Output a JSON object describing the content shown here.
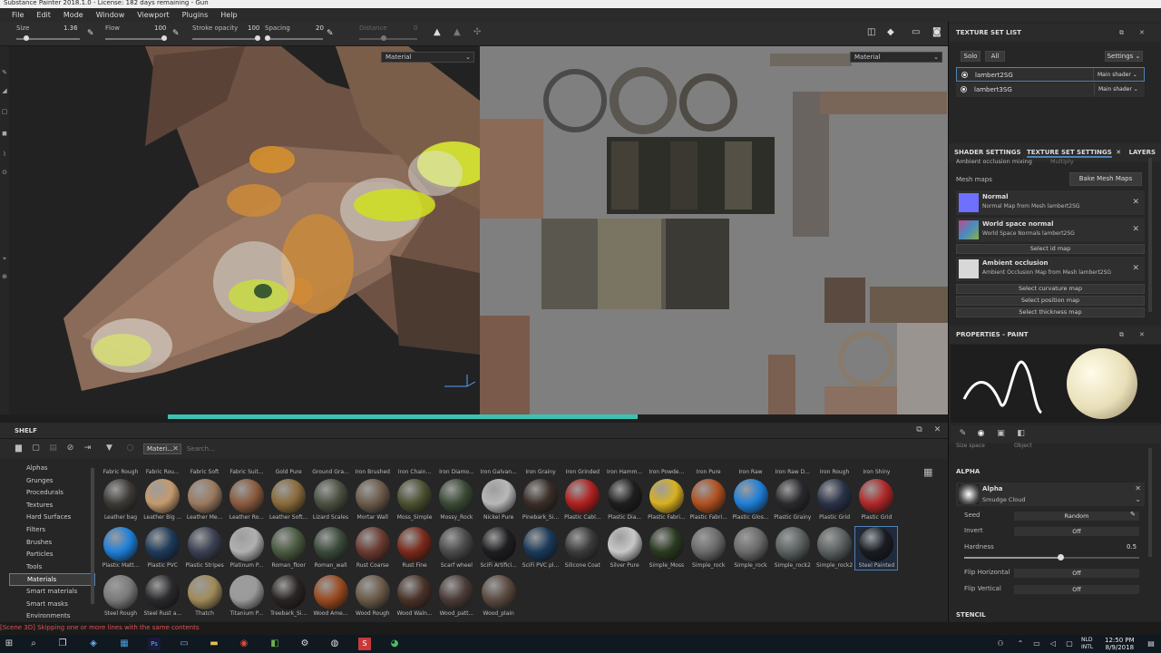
{
  "title": "Substance Painter 2018.1.0 - License: 182 days remaining - Gun",
  "menu": [
    "File",
    "Edit",
    "Mode",
    "Window",
    "Viewport",
    "Plugins",
    "Help"
  ],
  "toolbar": {
    "size_label": "Size",
    "size_value": "1.36",
    "flow_label": "Flow",
    "flow_value": "100",
    "stroke_label": "Stroke opacity",
    "stroke_value": "100",
    "spacing_label": "Spacing",
    "spacing_value": "20",
    "distance_label": "Distance"
  },
  "view3d": {
    "channel": "Material"
  },
  "view2d": {
    "channel": "Material"
  },
  "shelf": {
    "title": "SHELF",
    "filter_chip": "Materi...",
    "search_placeholder": "Search...",
    "categories": [
      "Alphas",
      "Grunges",
      "Procedurals",
      "Textures",
      "Hard Surfaces",
      "Filters",
      "Brushes",
      "Particles",
      "Tools",
      "Materials",
      "Smart materials",
      "Smart masks",
      "Environments"
    ],
    "selected_category": "Materials",
    "top_row": [
      "Fabric Rough",
      "Fabric Rou...",
      "Fabric Soft",
      "Fabric Suit...",
      "Gold Pure",
      "Ground Gra...",
      "Iron Brushed",
      "Iron Chain...",
      "Iron Diamo...",
      "Iron Galvan...",
      "Iron Grainy",
      "Iron Grinded",
      "Iron Hamm...",
      "Iron Powde...",
      "Iron Pure",
      "Iron Raw",
      "Iron Raw D...",
      "Iron Rough",
      "Iron Shiny"
    ],
    "rows": [
      [
        "Leather bag",
        "Leather Big ...",
        "Leather Me...",
        "Leather Ro...",
        "Leather Soft...",
        "Lizard Scales",
        "Mortar Wall",
        "Moss_Simple",
        "Mossy_Rock",
        "Nickel Pure",
        "Pinebark_Si...",
        "Plastic Cabl...",
        "Plastic Dia...",
        "Plastic Fabri...",
        "Plastic Fabri...",
        "Plastic Glos...",
        "Plastic Grainy",
        "Plastic Grid",
        "Plastic Grid"
      ],
      [
        "Plastic Matt...",
        "Plastic PVC",
        "Plastic Stripes",
        "Platinum P...",
        "Roman_floor",
        "Roman_wall",
        "Rust Coarse",
        "Rust Fine",
        "Scarf wheel",
        "SciFi Artifici...",
        "SciFi PVC pl...",
        "Silicone Coat",
        "Silver Pure",
        "Simple_Moss",
        "Simple_rock",
        "Simple_rock",
        "Simple_rock2",
        "Simple_rock2",
        "Steel Painted"
      ],
      [
        "Steel Rough",
        "Steel Rust a...",
        "Thatch",
        "Titanium P...",
        "Treebark_Si...",
        "Wood Ame...",
        "Wood Rough",
        "Wood Waln...",
        "Wood_patt...",
        "Wood_plain"
      ]
    ],
    "row_colors": [
      [
        "#3d3a36",
        "#c49a6e",
        "#9a7a5e",
        "#8a5a3e",
        "#8a6a3a",
        "#4a5040",
        "#6a5a4a",
        "#4a5030",
        "#3a4a35",
        "#b8b8b8",
        "#3a2e28",
        "#b02020",
        "#1e1e20",
        "#d9b020",
        "#b05020",
        "#1e7fd8",
        "#2a2a2e",
        "#2a3248",
        "#b02828"
      ],
      [
        "#1e7fd8",
        "#1e3a5a",
        "#3a4052",
        "#b0b0b0",
        "#4a5a40",
        "#3a4a3a",
        "#6a3a30",
        "#7a2a1a",
        "#4a4a4a",
        "#1e1e22",
        "#1a3a5a",
        "#3a3a3a",
        "#c8c8c8",
        "#2a3a20",
        "#6a6a6a",
        "#6a6a6a",
        "#5a6060",
        "#5a6060",
        "#1a1c22"
      ],
      [
        "#7a7a7a",
        "#2a2a2e",
        "#a08a5a",
        "#9a9a9a",
        "#2a2422",
        "#9a4a20",
        "#6a5a48",
        "#4a3228",
        "#4a3a36",
        "#5a4a40"
      ]
    ],
    "selected_material": "Steel Painted"
  },
  "texture_set_list": {
    "title": "TEXTURE SET LIST",
    "solo": "Solo",
    "all": "All",
    "settings": "Settings",
    "sets": [
      {
        "name": "lambert2SG",
        "shader": "Main shader"
      },
      {
        "name": "lambert3SG",
        "shader": "Main shader"
      }
    ]
  },
  "tabs": [
    "SHADER SETTINGS",
    "TEXTURE SET SETTINGS",
    "LAYERS"
  ],
  "tss": {
    "ao_mixing": "Ambient occlusion mixing",
    "ao_mixing_value": "Multiply",
    "mesh_maps": "Mesh maps",
    "bake": "Bake Mesh Maps",
    "maps": [
      {
        "name": "Normal",
        "sub": "Normal Map from Mesh lambert2SG",
        "color": "#7070ff"
      },
      {
        "name": "World space normal",
        "sub": "World Space Normals lambert2SG",
        "color": "#8a5ab0"
      },
      {
        "name": "Ambient occlusion",
        "sub": "Ambient Occlusion Map from Mesh lambert2SG",
        "color": "#d8d8d8"
      }
    ],
    "select_id": "Select id map",
    "select_curv": "Select curvature map",
    "select_pos": "Select position map",
    "select_thick": "Select thickness map"
  },
  "properties": {
    "title": "PROPERTIES - PAINT",
    "alpha_section": "ALPHA",
    "alpha_name": "Alpha",
    "alpha_sub": "Smudge Cloud",
    "seed_label": "Seed",
    "seed_value": "Random",
    "invert_label": "Invert",
    "invert_value": "Off",
    "hardness_label": "Hardness",
    "hardness_value": "0.5",
    "hardness_level": 0.55,
    "fliph_label": "Flip Horizontal",
    "fliph_value": "Off",
    "flipv_label": "Flip Vertical",
    "flipv_value": "Off",
    "stencil": "STENCIL",
    "space_label": "Size space",
    "space_value": "Object"
  },
  "status": "[Scene 3D] Skipping one or more lines with the same contents",
  "taskbar": {
    "lang1": "NLD",
    "lang2": "INTL",
    "time": "12:50 PM",
    "date": "8/9/2018"
  }
}
